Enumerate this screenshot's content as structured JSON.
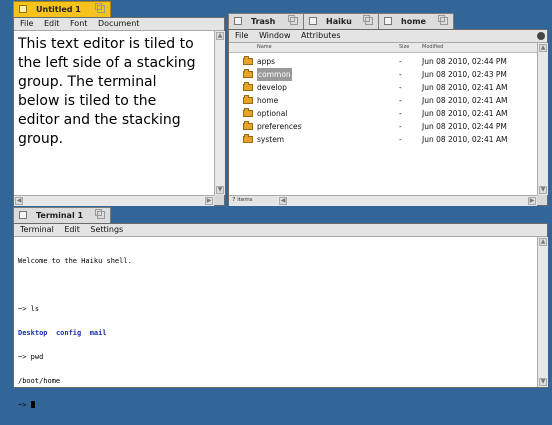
{
  "editor": {
    "tab_title": "Untitled 1",
    "menu": [
      "File",
      "Edit",
      "Font",
      "Document"
    ],
    "text": "This text editor is tiled to the left side of a stacking group. The terminal below is tiled to the editor and the stacking group."
  },
  "tracker": {
    "tabs": [
      "Trash",
      "Haiku",
      "home"
    ],
    "menu": [
      "File",
      "Window",
      "Attributes"
    ],
    "columns": {
      "name": "Name",
      "size": "Size",
      "modified": "Modified"
    },
    "rows": [
      {
        "name": "apps",
        "size": "-",
        "modified": "Jun 08 2010, 02:44 PM",
        "selected": false
      },
      {
        "name": "common",
        "size": "-",
        "modified": "Jun 08 2010, 02:43 PM",
        "selected": true
      },
      {
        "name": "develop",
        "size": "-",
        "modified": "Jun 08 2010, 02:41 AM",
        "selected": false
      },
      {
        "name": "home",
        "size": "-",
        "modified": "Jun 08 2010, 02:41 AM",
        "selected": false
      },
      {
        "name": "optional",
        "size": "-",
        "modified": "Jun 08 2010, 02:41 AM",
        "selected": false
      },
      {
        "name": "preferences",
        "size": "-",
        "modified": "Jun 08 2010, 02:44 PM",
        "selected": false
      },
      {
        "name": "system",
        "size": "-",
        "modified": "Jun 08 2010, 02:41 AM",
        "selected": false
      }
    ],
    "status": "7 items"
  },
  "terminal": {
    "tab_title": "Terminal 1",
    "menu": [
      "Terminal",
      "Edit",
      "Settings"
    ],
    "welcome": "Welcome to the Haiku shell.",
    "cmd1": "~> ls",
    "ls_output": [
      "Desktop",
      "config",
      "mail"
    ],
    "cmd2": "~> pwd",
    "pwd_output": "/boot/home",
    "prompt": "~> "
  },
  "colors": {
    "desktop": "#336698",
    "active_tab": "#f6c21c",
    "terminal_link": "#1a2fa8"
  }
}
